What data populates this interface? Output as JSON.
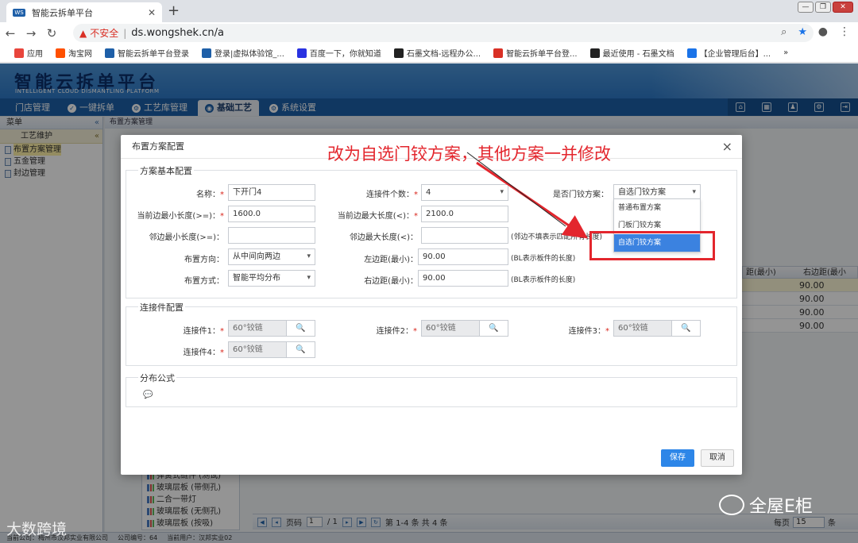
{
  "browser": {
    "tab_title": "智能云拆单平台",
    "tab_favicon": "WS",
    "new_tab": "+",
    "win_min": "—",
    "win_max": "❐",
    "win_close": "✕",
    "insecure_label": "不安全",
    "url": "ds.wongshek.cn/a",
    "bookmarks": [
      {
        "label": "应用",
        "icon_color": "#e8453c"
      },
      {
        "label": "淘宝网",
        "icon_color": "#ff5000"
      },
      {
        "label": "智能云拆单平台登录",
        "icon_color": "#1e5fa8"
      },
      {
        "label": "登录|虚拟体验馆_...",
        "icon_color": "#1e5fa8"
      },
      {
        "label": "百度一下，你就知道",
        "icon_color": "#2932e1"
      },
      {
        "label": "石墨文档-远程办公...",
        "icon_color": "#222222"
      },
      {
        "label": "智能云拆单平台登...",
        "icon_color": "#d93025"
      },
      {
        "label": "最近使用 - 石墨文档",
        "icon_color": "#222222"
      },
      {
        "label": "【企业管理后台】...",
        "icon_color": "#1a73e8"
      }
    ],
    "more_bookmarks": "»"
  },
  "app": {
    "logo_cn": "智能云拆单平台",
    "logo_en": "INTELLIGENT CLOUD DISMANTLING PLATFORM",
    "menu": [
      {
        "label": "门店管理",
        "active": false
      },
      {
        "label": "一键拆单",
        "active": false
      },
      {
        "label": "工艺库管理",
        "active": false
      },
      {
        "label": "基础工艺",
        "active": true
      },
      {
        "label": "系统设置",
        "active": false
      }
    ],
    "toolbar_icons": [
      "home-icon",
      "calendar-icon",
      "user-icon",
      "gear-icon",
      "logout-icon"
    ]
  },
  "sidebar": {
    "header": "菜单",
    "collapse": "«",
    "group": "工艺维护",
    "group_collapse": "«",
    "items": [
      {
        "label": "布置方案管理",
        "selected": true
      },
      {
        "label": "五金管理",
        "selected": false
      },
      {
        "label": "封边管理",
        "selected": false
      }
    ]
  },
  "background": {
    "breadcrumb": "布置方案管理",
    "grid_header": [
      "距(最小)",
      "右边距(最小"
    ],
    "grid_rows": [
      "90.00",
      "90.00",
      "90.00",
      "90.00"
    ],
    "tree_items": [
      "弹簧式链件 (测试)",
      "玻璃层板 (带侧孔)",
      "二合一带灯",
      "玻璃层板 (无侧孔)",
      "玻璃层板 (按吸)"
    ],
    "pager": {
      "page_label": "页码",
      "page_value": "1",
      "page_total": "/ 1",
      "range": "第 1-4 条  共 4 条",
      "per_page_label": "每页",
      "per_page_value": "15",
      "per_page_unit": "条"
    },
    "status": [
      "当前公司：梅州市汉邦实业有限公司",
      "公司编号：64",
      "当前用户：汉邦实业02"
    ]
  },
  "modal": {
    "title": "布置方案配置",
    "close": "×",
    "sections": {
      "basic": "方案基本配置",
      "connector": "连接件配置",
      "formula": "分布公式"
    },
    "fields": {
      "name_label": "名称：",
      "name_value": "下开门4",
      "count_label": "连接件个数：",
      "count_value": "4",
      "door_label": "是否门铰方案：",
      "door_value": "自选门铰方案",
      "min_len_label": "当前边最小长度(>=)：",
      "min_len_value": "1600.0",
      "max_len_label": "当前边最大长度(<)：",
      "max_len_value": "2100.0",
      "adj_min_label": "邻边最小长度(>=)：",
      "adj_min_value": "",
      "adj_max_label": "邻边最大长度(<)：",
      "adj_max_value": "",
      "adj_hint": "(邻边不填表示匹配所有长度)",
      "direction_label": "布置方向：",
      "direction_value": "从中间向两边",
      "left_margin_label": "左边距(最小)：",
      "left_margin_value": "90.00",
      "left_hint": "(BL表示板件的长度)",
      "mode_label": "布置方式：",
      "mode_value": "智能平均分布",
      "right_margin_label": "右边距(最小)：",
      "right_margin_value": "90.00",
      "right_hint": "(BL表示板件的长度)",
      "required_mark": "*"
    },
    "dropdown_options": [
      "普通布置方案",
      "门板门铰方案",
      "自选门铰方案"
    ],
    "connectors": [
      {
        "label": "连接件1：",
        "value": "60°铰链"
      },
      {
        "label": "连接件2：",
        "value": "60°铰链"
      },
      {
        "label": "连接件3：",
        "value": "60°铰链"
      },
      {
        "label": "连接件4：",
        "value": "60°铰链"
      }
    ],
    "save_label": "保存",
    "cancel_label": "取消"
  },
  "annotation": {
    "text": "改为自选门铰方案，其他方案一并修改",
    "color": "#e3262d"
  },
  "watermarks": {
    "left": "大数跨境",
    "right": "全屋E柜"
  }
}
